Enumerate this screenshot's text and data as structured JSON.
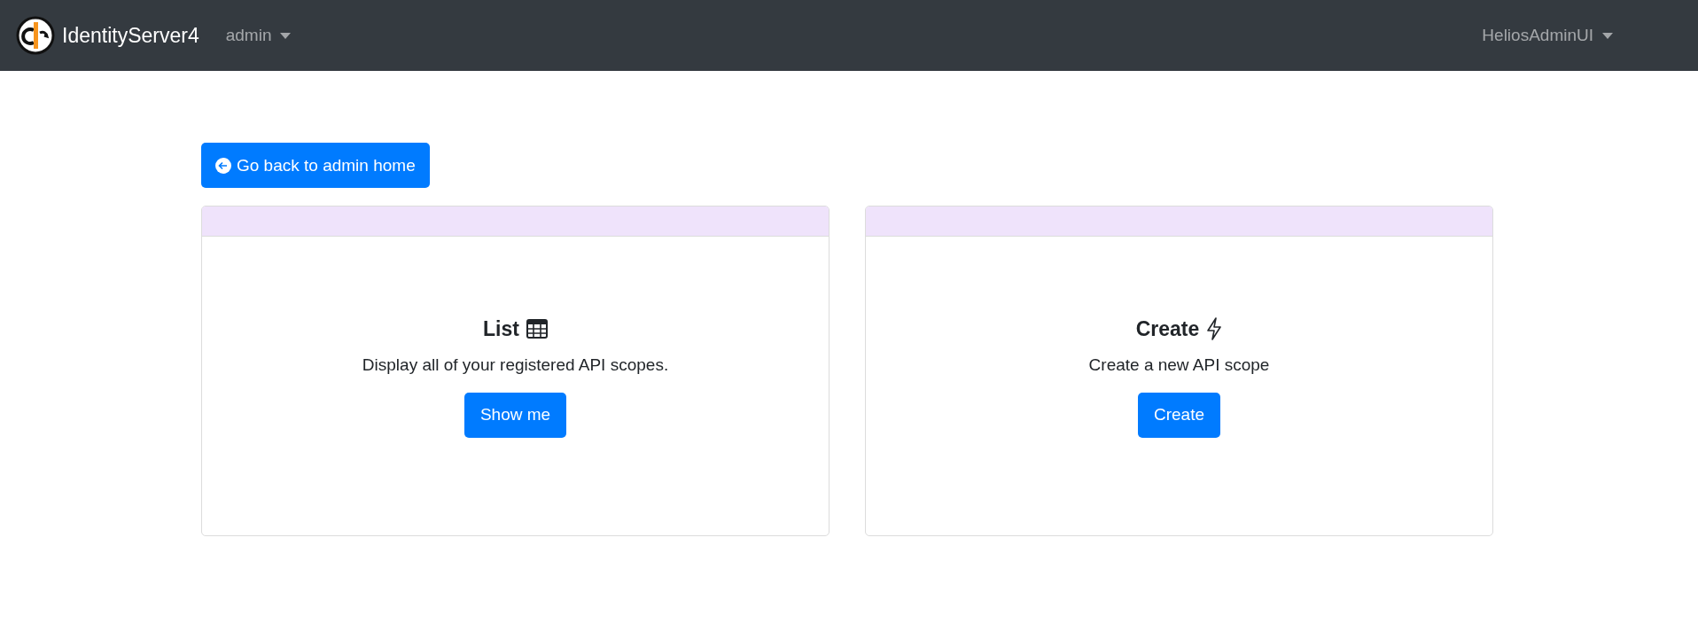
{
  "navbar": {
    "brand": "IdentityServer4",
    "menus": [
      {
        "label": "admin"
      }
    ],
    "user_menu": {
      "label": "HeliosAdminUI"
    }
  },
  "back_button": {
    "label": "Go back to admin home"
  },
  "cards": [
    {
      "kind": "list",
      "title": "List",
      "description": "Display all of your registered API scopes.",
      "button": "Show me"
    },
    {
      "kind": "create",
      "title": "Create",
      "description": "Create a new API scope",
      "button": "Create"
    }
  ]
}
